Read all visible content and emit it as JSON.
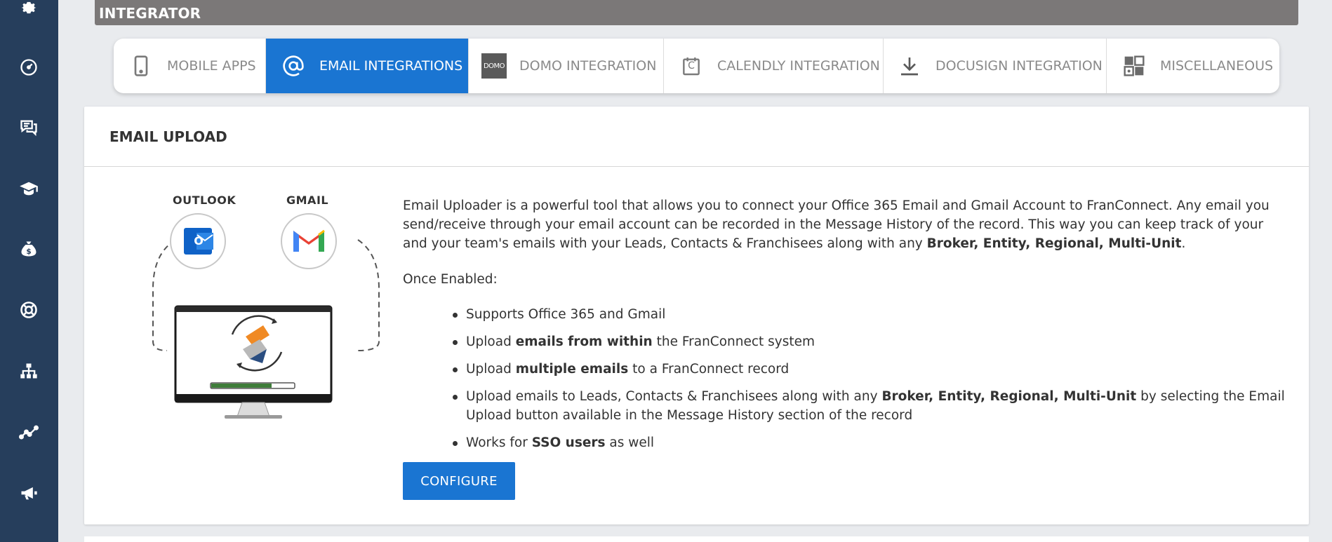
{
  "header": {
    "title": "INTEGRATOR"
  },
  "tabs": [
    {
      "label": "MOBILE APPS",
      "icon": "mobile-phone-icon",
      "active": false
    },
    {
      "label": "EMAIL INTEGRATIONS",
      "icon": "at-sign-icon",
      "active": true
    },
    {
      "label": "DOMO INTEGRATION",
      "icon": "domo-logo-icon",
      "icon_text": "DOMO",
      "active": false
    },
    {
      "label": "CALENDLY INTEGRATION",
      "icon": "calendly-icon",
      "icon_text": "C",
      "active": false
    },
    {
      "label": "DOCUSIGN INTEGRATION",
      "icon": "download-icon",
      "active": false
    },
    {
      "label": "MISCELLANEOUS",
      "icon": "grid-icon",
      "active": false
    }
  ],
  "card": {
    "title": "EMAIL UPLOAD",
    "illustration": {
      "left_label": "OUTLOOK",
      "right_label": "GMAIL",
      "outlook_letter": "O"
    },
    "description": {
      "part1": "Email Uploader is a powerful tool that allows you to connect your Office 365 Email and Gmail Account to FranConnect. Any email you send/receive through your email account can be recorded in the Message History of the record. This way you can keep track of your and your team's emails with your Leads, Contacts & Franchisees along with any ",
      "bold": "Broker, Entity, Regional, Multi-Unit",
      "part2": "."
    },
    "once_enabled": "Once Enabled:",
    "bullets": [
      {
        "pre": "Supports Office 365 and Gmail",
        "bold": "",
        "post": ""
      },
      {
        "pre": "Upload ",
        "bold": "emails from within",
        "post": " the FranConnect system"
      },
      {
        "pre": "Upload ",
        "bold": "multiple emails",
        "post": " to a FranConnect record"
      },
      {
        "pre": "Upload emails to Leads, Contacts & Franchisees along with any ",
        "bold": "Broker, Entity, Regional, Multi-Unit",
        "post": " by selecting the Email Upload button available in the Message History section of the record"
      },
      {
        "pre": "Works for ",
        "bold": "SSO users",
        "post": " as well"
      }
    ],
    "configure_label": "CONFIGURE"
  },
  "sidebar": {
    "icons": [
      "gear-icon",
      "gauge-icon",
      "chat-icon",
      "graduation-cap-icon",
      "money-bag-icon",
      "lifebuoy-icon",
      "hierarchy-icon",
      "trend-line-icon",
      "megaphone-icon"
    ]
  },
  "colors": {
    "sidebar": "#263e5c",
    "accent": "#1a75d2",
    "header_bar": "#7b7878"
  }
}
